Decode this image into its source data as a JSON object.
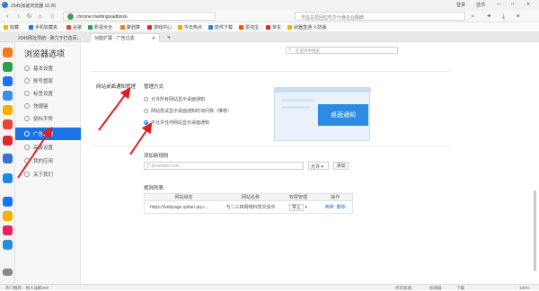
{
  "window": {
    "title": "2345加速浏览器 10.26",
    "controls": [
      "登录",
      "选项",
      "—",
      "□",
      "✕"
    ]
  },
  "addressbar": {
    "url": "chrome://settings/adblock",
    "search_placeholder": "市监总局回应吃华为食企业翻牌"
  },
  "bookmarks": [
    {
      "label": "收藏",
      "color": "#f0b400"
    },
    {
      "label": "手机收藏夹",
      "color": "#1a73e8"
    },
    {
      "label": "谷歌",
      "color": "#e94335"
    },
    {
      "label": "影视大全",
      "color": "#2e9e4f"
    },
    {
      "label": "聚划算",
      "color": "#f47a20"
    },
    {
      "label": "游戏中心",
      "color": "#e0272c"
    },
    {
      "label": "今日热点",
      "color": "#f3a600"
    },
    {
      "label": "软件下载",
      "color": "#2a7fd6"
    },
    {
      "label": "爱淘宝",
      "color": "#ff5000"
    },
    {
      "label": "京东",
      "color": "#e0272c"
    },
    {
      "label": "武器直通 人防版",
      "color": "#f0b400"
    }
  ],
  "tabs": [
    {
      "label": "2345网址导航 - 致力于打造百...",
      "active": false
    },
    {
      "label": "功能扩展 - 广告过滤",
      "active": true
    },
    {
      "label": "+",
      "active": false
    }
  ],
  "sidebar": {
    "heading": "浏览器选项",
    "items": [
      {
        "label": "基本设置",
        "active": false
      },
      {
        "label": "账号管家",
        "active": false
      },
      {
        "label": "标签设置",
        "active": false
      },
      {
        "label": "快捷键",
        "active": false
      },
      {
        "label": "鼠标手势",
        "active": false
      },
      {
        "label": "广告过滤",
        "active": true
      },
      {
        "label": "高级设置",
        "active": false
      },
      {
        "label": "我的应用",
        "active": false
      },
      {
        "label": "关于我们",
        "active": false
      }
    ]
  },
  "content": {
    "search_placeholder": "在选项中搜索",
    "section_label": "网站桌面通知管理",
    "mode_title": "管理方式",
    "options": [
      {
        "label": "允许所有网站显示桌面通知",
        "selected": false
      },
      {
        "label": "网站尝试显示桌面通知时询问我（推荐）",
        "selected": false
      },
      {
        "label": "不允许任何网站显示桌面通知",
        "selected": true
      }
    ],
    "preview_text": "桌面通知",
    "add_rule_title": "添加新规则",
    "rule_placeholder": "[*.]example.com",
    "rule_select": "允许",
    "add_button": "添加",
    "rule_list_title": "规则列表",
    "table": {
      "headers": [
        "网站域名",
        "网站名称",
        "权限管理",
        "操作"
      ],
      "rows": [
        {
          "domain": "https://webpage.qidian.qq.c...",
          "name": "与二三四网络科技交谈中",
          "permission": "禁止",
          "action_edit": "两转",
          "action_delete": "删除"
        }
      ]
    }
  },
  "statusbar": {
    "left": "热门推荐：他人误解200",
    "zoom": "100%",
    "right_items": [
      "优化加速",
      "加速器",
      "下载",
      "100%"
    ]
  }
}
